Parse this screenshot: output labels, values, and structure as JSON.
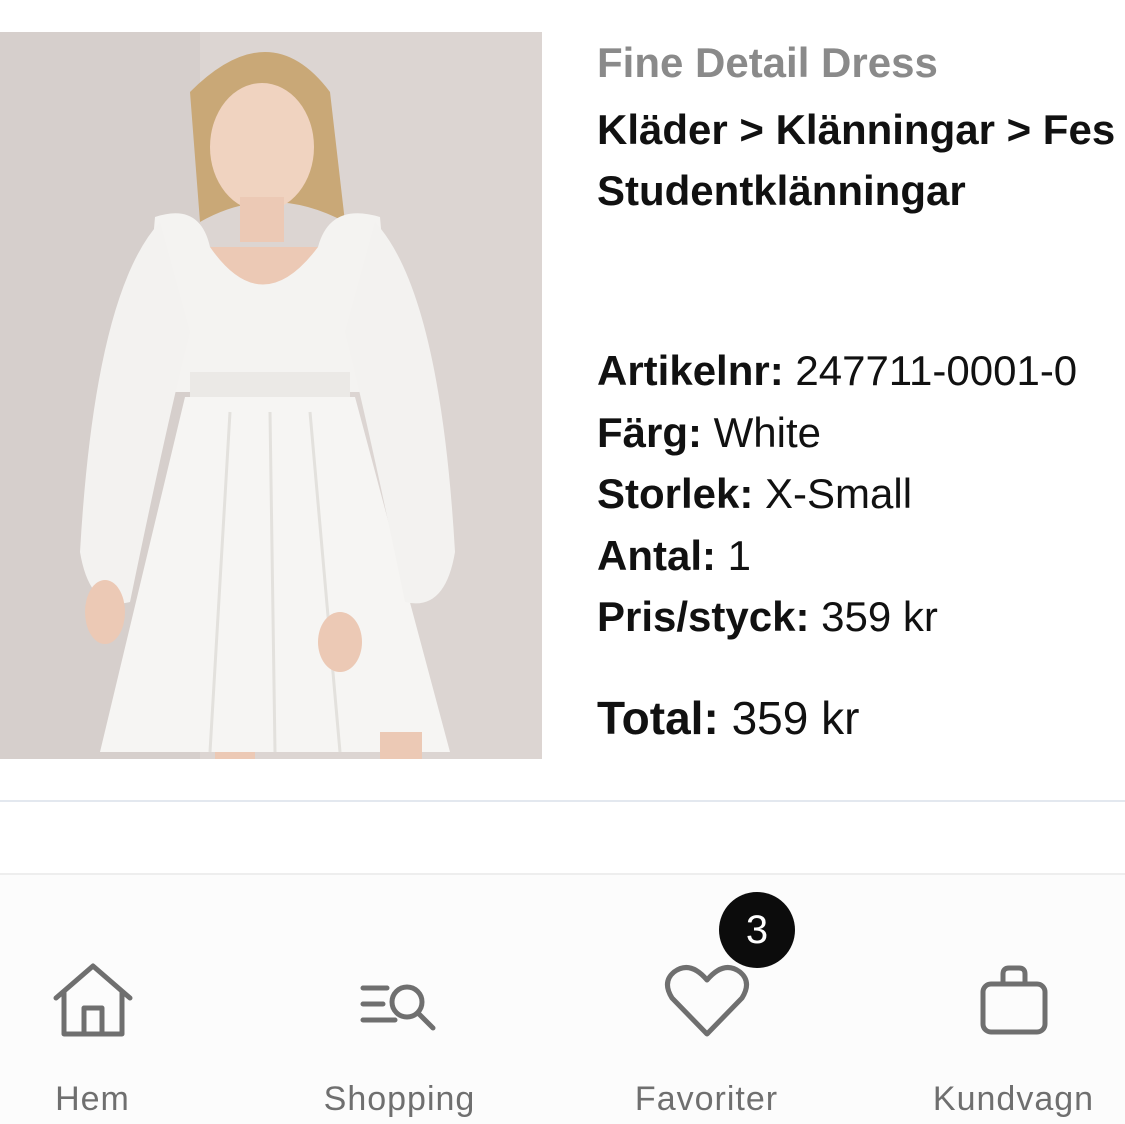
{
  "product": {
    "name": "Fine Detail Dress",
    "breadcrumb_line1": "Kläder > Klänningar > Fes",
    "breadcrumb_line2": "Studentklänningar",
    "details": [
      {
        "key": "Artikelnr:",
        "value": " 247711-0001-0"
      },
      {
        "key": "Färg:",
        "value": " White"
      },
      {
        "key": "Storlek:",
        "value": " X-Small"
      },
      {
        "key": "Antal:",
        "value": " 1"
      },
      {
        "key": "Pris/styck:",
        "value": " 359 kr"
      }
    ],
    "total_key": "Total:",
    "total_value": " 359 kr"
  },
  "tabbar": {
    "tabs": [
      {
        "label": "Hem",
        "icon": "home-icon"
      },
      {
        "label": "Shopping",
        "icon": "search-list-icon"
      },
      {
        "label": "Favoriter",
        "icon": "heart-icon"
      },
      {
        "label": "Kundvagn",
        "icon": "bag-icon"
      }
    ],
    "favorites_badge": "3"
  },
  "colors": {
    "text": "#111111",
    "muted": "#8a8a8a",
    "tab_icon": "#6f6f6f",
    "badge": "#0c0c0c"
  }
}
